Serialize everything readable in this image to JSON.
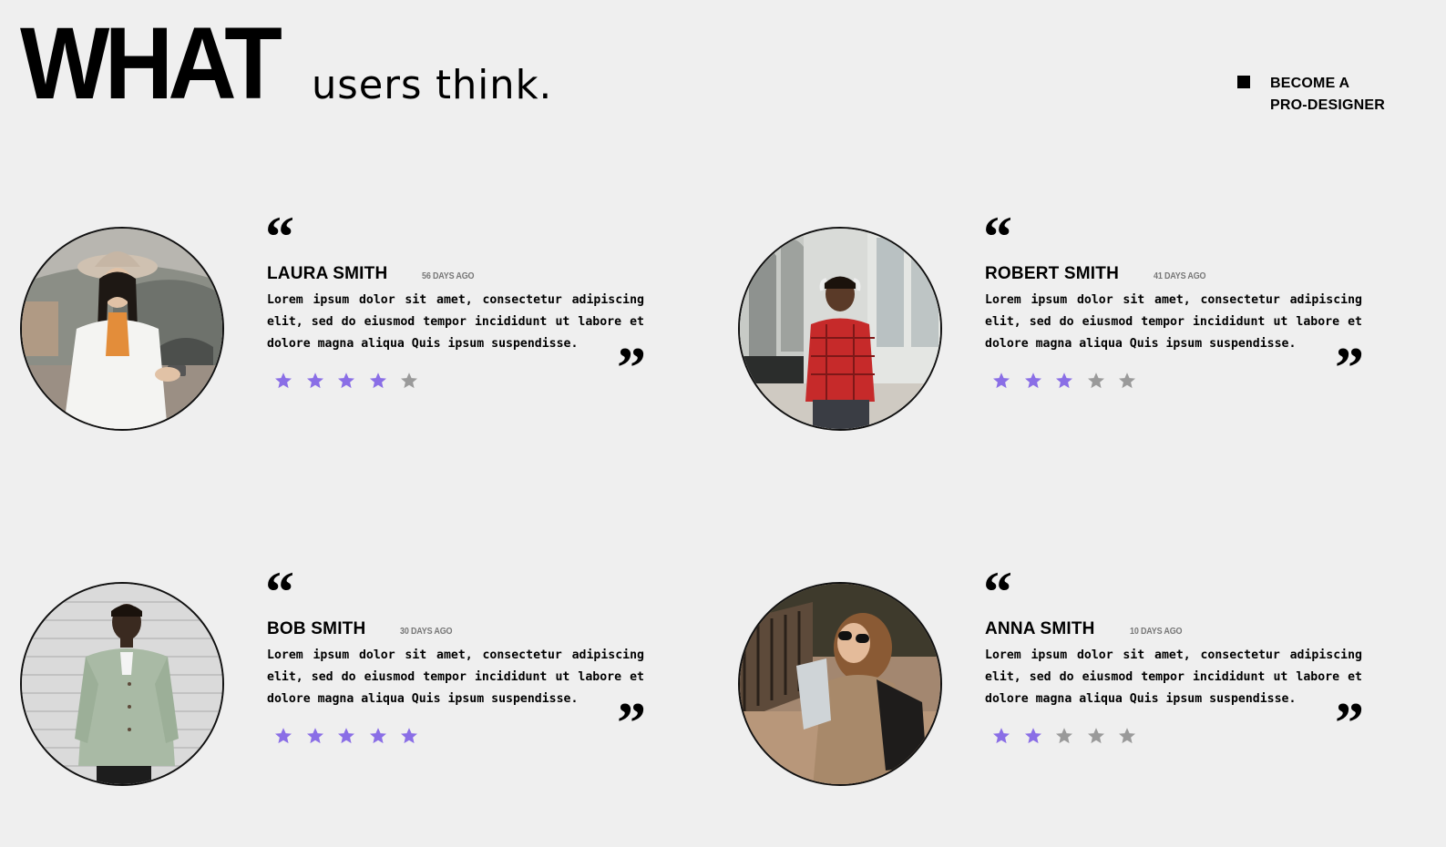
{
  "header": {
    "title_big": "WHAT",
    "title_small": "users think."
  },
  "cta": {
    "line1": "BECOME A",
    "line2": "PRO-DESIGNER"
  },
  "colors": {
    "background": "#efefef",
    "star_active": "#8a6ee6",
    "star_inactive": "#9a9a9a",
    "text": "#000000"
  },
  "quote_marks": {
    "open": "“",
    "close": "”"
  },
  "reviews": [
    {
      "name": "LAURA SMITH",
      "days": "56 DAYS AGO",
      "text": "Lorem ipsum dolor sit amet, consectetur adipiscing elit, sed do eiusmod tempor incididunt ut labore et dolore magna aliqua Quis ipsum suspendisse.",
      "rating": 4,
      "max": 5,
      "avatar_icon": "woman-with-hat-photo"
    },
    {
      "name": "ROBERT SMITH",
      "days": "41 DAYS AGO",
      "text": "Lorem ipsum dolor sit amet, consectetur adipiscing elit, sed do eiusmod tempor incididunt ut labore et dolore magna aliqua Quis ipsum suspendisse.",
      "rating": 3,
      "max": 5,
      "avatar_icon": "man-red-shirt-photo"
    },
    {
      "name": "BOB SMITH",
      "days": "30 DAYS AGO",
      "text": "Lorem ipsum dolor sit amet, consectetur adipiscing elit, sed do eiusmod tempor incididunt ut labore et dolore magna aliqua Quis ipsum suspendisse.",
      "rating": 5,
      "max": 5,
      "avatar_icon": "man-green-jacket-photo"
    },
    {
      "name": "ANNA SMITH",
      "days": "10 DAYS AGO",
      "text": "Lorem ipsum dolor sit amet, consectetur adipiscing elit, sed do eiusmod tempor incididunt ut labore et dolore magna aliqua Quis ipsum suspendisse.",
      "rating": 2,
      "max": 5,
      "avatar_icon": "woman-sunglasses-photo"
    }
  ]
}
